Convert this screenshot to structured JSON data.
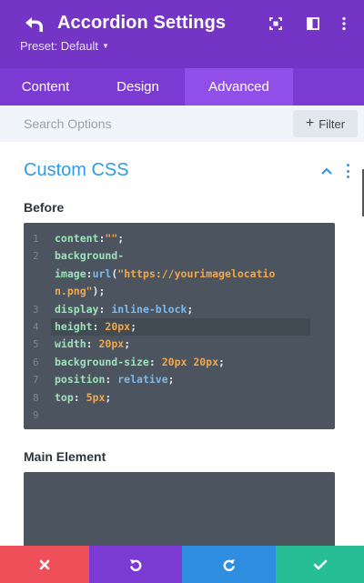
{
  "header": {
    "title": "Accordion Settings",
    "preset_label": "Preset: Default",
    "background": "#7435c7"
  },
  "tabs": [
    {
      "label": "Content",
      "active": false
    },
    {
      "label": "Design",
      "active": false
    },
    {
      "label": "Advanced",
      "active": true
    }
  ],
  "search": {
    "placeholder": "Search Options",
    "filter_label": "Filter"
  },
  "section": {
    "title": "Custom CSS",
    "accent": "#2d9ce7"
  },
  "fields": {
    "before": {
      "label": "Before",
      "line_numbers": [
        "1",
        "2",
        "",
        "",
        "3",
        "4",
        "5",
        "6",
        "7",
        "8",
        "9"
      ],
      "active_line": 4
    },
    "main_element": {
      "label": "Main Element"
    }
  },
  "footer": {
    "colors": {
      "discard": "#ef4f58",
      "undo": "#7b3bd2",
      "redo": "#2f8ee0",
      "save": "#26bd97"
    }
  }
}
